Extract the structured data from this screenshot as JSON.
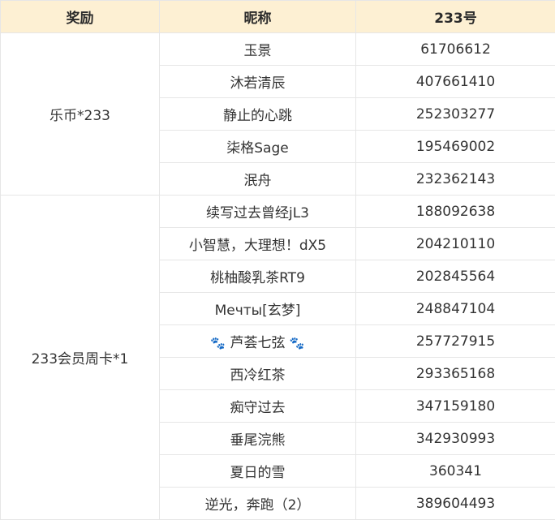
{
  "table": {
    "headers": [
      "奖励",
      "昵称",
      "233号"
    ],
    "groups": [
      {
        "reward": "乐币*233",
        "rows": [
          {
            "nickname": "玉景",
            "id": "61706612"
          },
          {
            "nickname": "沐若清辰",
            "id": "407661410"
          },
          {
            "nickname": "静止的心跳",
            "id": "252303277"
          },
          {
            "nickname": "柒格Sage",
            "id": "195469002"
          },
          {
            "nickname": "泯舟",
            "id": "232362143"
          }
        ]
      },
      {
        "reward": "233会员周卡*1",
        "rows": [
          {
            "nickname": "续写过去曾经jL3",
            "id": "188092638"
          },
          {
            "nickname": "小智慧，大理想！dX5",
            "id": "204210110"
          },
          {
            "nickname": "桃柚酸乳茶RT9",
            "id": "202845564"
          },
          {
            "nickname": "Мечты[玄梦]",
            "id": "248847104"
          },
          {
            "nickname": "芦荟七弦",
            "prefix_icon": "paw-prints-icon",
            "suffix_icon": "paw-prints-icon",
            "id": "257727915"
          },
          {
            "nickname": "西冷红茶",
            "id": "293365168"
          },
          {
            "nickname": "痴守过去",
            "id": "347159180"
          },
          {
            "nickname": "垂尾浣熊",
            "id": "342930993"
          },
          {
            "nickname": "夏日的雪",
            "id": "360341"
          },
          {
            "nickname": "逆光，奔跑（2）",
            "id": "389604493"
          }
        ]
      }
    ]
  },
  "colors": {
    "header_bg": "#fdf0d3",
    "border": "#e6e6e6",
    "text": "#333333"
  }
}
